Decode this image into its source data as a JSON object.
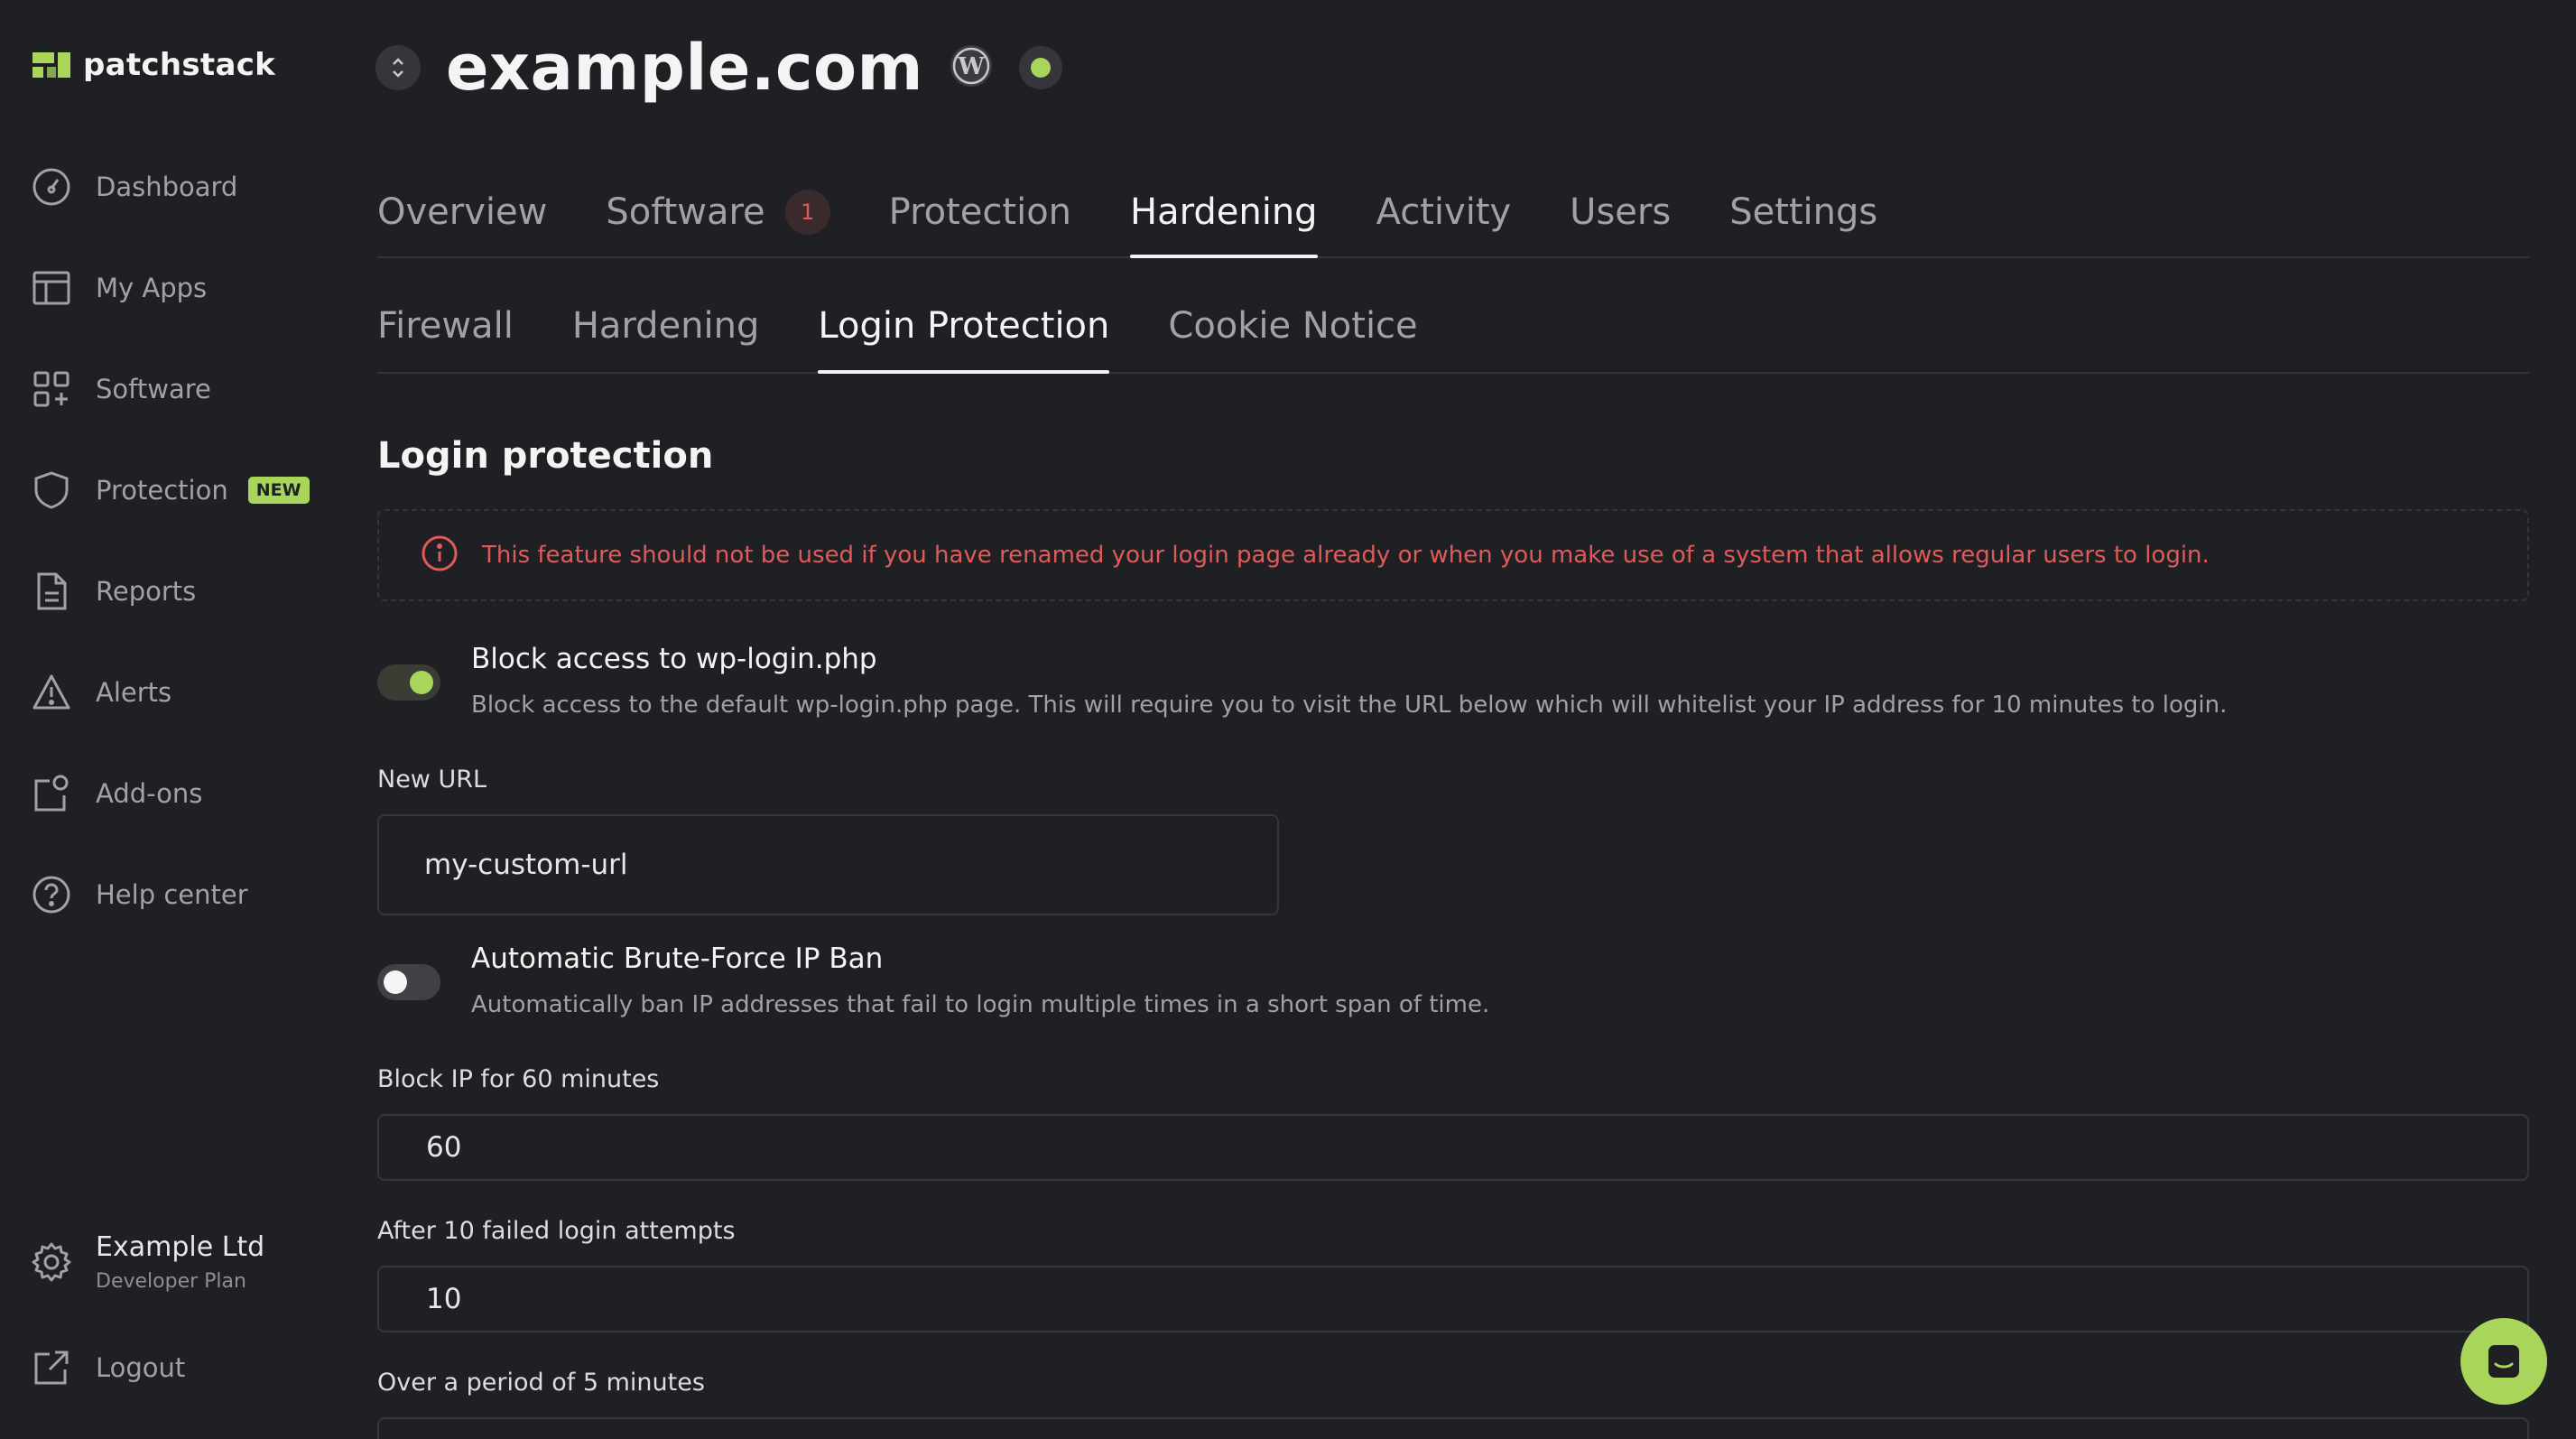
{
  "brand": {
    "name": "patchstack",
    "accent": "#a8d55a"
  },
  "sidebar": {
    "items": [
      {
        "label": "Dashboard",
        "icon": "gauge-icon"
      },
      {
        "label": "My Apps",
        "icon": "layout-icon"
      },
      {
        "label": "Software",
        "icon": "apps-grid-icon"
      },
      {
        "label": "Protection",
        "icon": "shield-icon",
        "badge": "NEW"
      },
      {
        "label": "Reports",
        "icon": "document-icon"
      },
      {
        "label": "Alerts",
        "icon": "warning-icon"
      },
      {
        "label": "Add-ons",
        "icon": "addon-icon"
      },
      {
        "label": "Help center",
        "icon": "help-icon"
      }
    ],
    "org": {
      "name": "Example Ltd",
      "plan": "Developer Plan"
    },
    "logout": "Logout"
  },
  "site": {
    "title": "example.com",
    "status": "online"
  },
  "main_tabs": [
    {
      "label": "Overview"
    },
    {
      "label": "Software",
      "count": "1"
    },
    {
      "label": "Protection"
    },
    {
      "label": "Hardening",
      "active": true
    },
    {
      "label": "Activity"
    },
    {
      "label": "Users"
    },
    {
      "label": "Settings"
    }
  ],
  "sub_tabs": [
    {
      "label": "Firewall"
    },
    {
      "label": "Hardening"
    },
    {
      "label": "Login Protection",
      "active": true
    },
    {
      "label": "Cookie Notice"
    }
  ],
  "section": {
    "title": "Login protection",
    "warning": "This feature should not be used if you have renamed your login page already or when you make use of a system that allows regular users to login."
  },
  "block_login": {
    "title": "Block access to wp-login.php",
    "description": "Block access to the default wp-login.php page. This will require you to visit the URL below which will whitelist your IP address for 10 minutes to login.",
    "enabled": true
  },
  "new_url": {
    "label": "New URL",
    "value": "my-custom-url"
  },
  "brute_force": {
    "title": "Automatic Brute-Force IP Ban",
    "description": "Automatically ban IP addresses that fail to login multiple times in a short span of time.",
    "enabled": false
  },
  "block_minutes": {
    "label": "Block IP for 60 minutes",
    "value": "60"
  },
  "failed_attempts": {
    "label": "After 10 failed login attempts",
    "value": "10"
  },
  "period": {
    "label": "Over a period of 5 minutes"
  }
}
